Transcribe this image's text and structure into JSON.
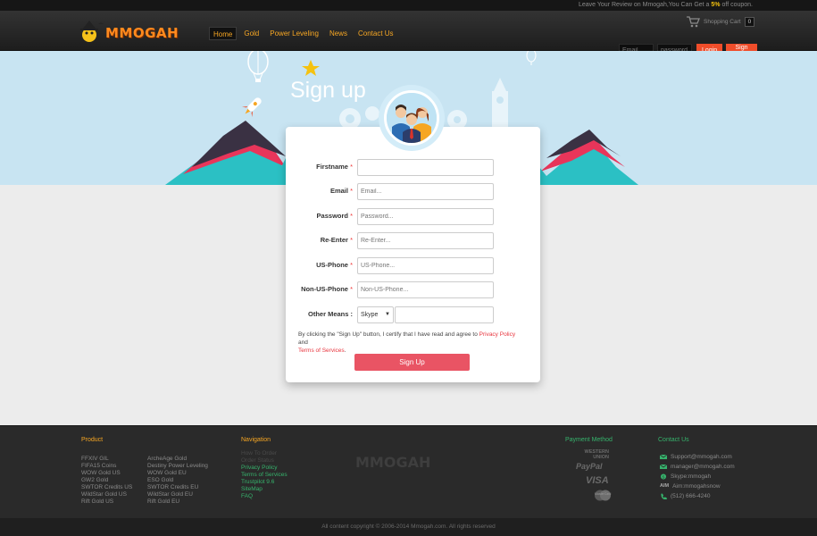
{
  "topbar": {
    "text_pre": "Leave Your Review on Mmogah,You Can Get a ",
    "percent": "5%",
    "text_post": " off coupon."
  },
  "header": {
    "logo_text": "MMOGAH",
    "nav": [
      "Home",
      "Gold",
      "Power Leveling",
      "News",
      "Contact Us"
    ],
    "cart_label": "Shopping Cart",
    "cart_count": "0",
    "email_placeholder": "Email",
    "password_placeholder": "password",
    "login_label": "Login",
    "signup_label": "Sign Up"
  },
  "hero": {
    "title": "Sign up"
  },
  "form": {
    "firstname_label": "Firstname",
    "email_label": "Email",
    "password_label": "Password",
    "reenter_label": "Re-Enter",
    "us_phone_label": "US-Phone",
    "non_us_phone_label": "Non-US-Phone",
    "other_means_label": "Other Means :",
    "required_mark": "*",
    "email_placeholder": "Email...",
    "password_placeholder": "Password...",
    "reenter_placeholder": "Re-Enter...",
    "us_phone_placeholder": "US-Phone...",
    "non_us_phone_placeholder": "Non-US-Phone...",
    "other_means_selected": "Skype",
    "terms_pre": "By clicking the \"Sign Up\" button, I certify that I have read and agree to ",
    "privacy_link": "Privacy Policy",
    "terms_and": " and",
    "terms_link": "Terms of Services",
    "terms_end": ".",
    "submit_label": "Sign Up"
  },
  "footer": {
    "product_title": "Product",
    "product_col1": [
      "FFXIV GIL",
      "FIFA15 Coins",
      "WOW Gold US",
      "GW2 Gold",
      "SWTOR Credits US",
      "WildStar Gold US",
      "Rift Gold US"
    ],
    "product_col2": [
      "ArcheAge Gold",
      "Destiny Power Leveling",
      "WOW Gold EU",
      "ESO Gold",
      "SWTOR Credits EU",
      "WildStar Gold EU",
      "Rift Gold EU"
    ],
    "nav_title": "Navigation",
    "nav_dim": [
      "How To Order",
      "Order Status"
    ],
    "nav_items": [
      "Privacy Policy",
      "Terms of Services",
      "Trustpilot 9.6",
      "SiteMap",
      "FAQ"
    ],
    "payment_title": "Payment Method",
    "payment_methods": [
      "WESTERN UNION",
      "PayPal",
      "VISA",
      "MasterCard"
    ],
    "contact_title": "Contact Us",
    "contacts": [
      "Support@mmogah.com",
      "manager@mmogah.com",
      "Skype:mmogah",
      "Aim:mmogahsnow",
      "(512) 666-4240"
    ],
    "aim_label": "AIM",
    "copyright": "All content copyright © 2006-2014 Mmogah.com. All rights reserved"
  },
  "colors": {
    "accent_orange": "#f6a623",
    "button_red": "#f04d2a",
    "signup_pink": "#e95464",
    "footer_green": "#36b36c"
  }
}
